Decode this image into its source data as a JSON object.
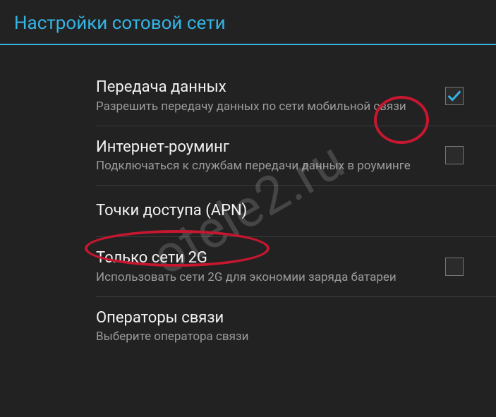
{
  "colors": {
    "accent": "#33b5e5",
    "highlight": "#c5172f",
    "bg": "#222222"
  },
  "header": {
    "title": "Настройки сотовой сети"
  },
  "watermark": "otele2.ru",
  "rows": {
    "data": {
      "title": "Передача данных",
      "sub": "Разрешить передачу данных по сети мобильной связи",
      "checked": true
    },
    "roaming": {
      "title": "Интернет-роуминг",
      "sub": "Подключаться к службам передачи данных в роуминге",
      "checked": false
    },
    "apn": {
      "title": "Точки доступа (APN)"
    },
    "only2g": {
      "title": "Только сети 2G",
      "sub": "Использовать сети 2G для экономии заряда батареи",
      "checked": false
    },
    "operators": {
      "title": "Операторы связи",
      "sub": "Выберите оператора связи"
    }
  }
}
